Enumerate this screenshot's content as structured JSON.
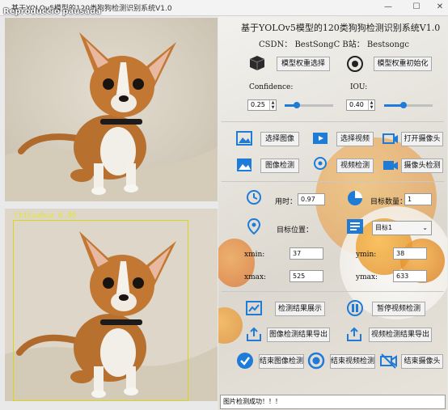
{
  "window": {
    "title": "基于YOLOv5模型的120类狗狗检测识别系统V1.0",
    "overlay": "Reproduccio pausada",
    "controls": [
      "—",
      "☐",
      "✕"
    ]
  },
  "detection": {
    "label": "Chihuahua 0.80"
  },
  "panel": {
    "title": "基于YOLOv5模型的120类狗狗检测识别系统V1.0",
    "csdn": "CSDN： BestSongC  B站： Bestsongc",
    "model_select_label": "模型权重选择",
    "model_init_label": "模型权重初始化",
    "confidence_label": "Confidence:",
    "iou_label": "IOU:",
    "confidence_value": "0.25",
    "iou_value": "0.40",
    "confidence_level": 0.25,
    "iou_level": 0.4,
    "select_image_label": "选择图像",
    "select_video_label": "选择视频",
    "open_camera_label": "打开摄像头",
    "image_detect_label": "图像检测",
    "video_detect_label": "视频检测",
    "camera_detect_label": "摄像头检测",
    "time_label": "用时：",
    "time_value": "0.97",
    "count_label": "目标数量：",
    "count_value": "1",
    "position_label": "目标位置：",
    "target_select": "目标1",
    "xmin_label": "xmin:",
    "xmin_value": "37",
    "ymin_label": "ymin:",
    "ymin_value": "38",
    "xmax_label": "xmax:",
    "xmax_value": "525",
    "ymax_label": "ymax:",
    "ymax_value": "633",
    "show_result_label": "检测结果展示",
    "pause_video_label": "暂停视频检测",
    "export_image_label": "图像检测结果导出",
    "export_video_label": "视频检测结果导出",
    "end_image_label": "结束图像检测",
    "end_video_label": "结束视频检测",
    "end_camera_label": "结束摄像头",
    "status_text": "图片检测成功！！！"
  },
  "colors": {
    "accent": "#1e7bd8",
    "box": "#d6d61a"
  }
}
